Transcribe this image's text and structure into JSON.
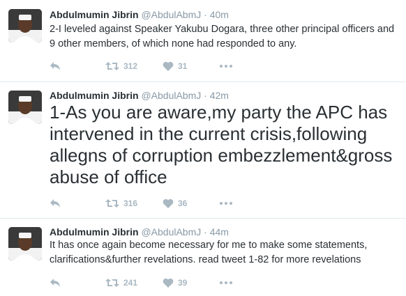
{
  "tweets": [
    {
      "name": "Abdulmumin Jibrin",
      "handle": "@AbdulAbmJ",
      "separator": "·",
      "time": "40m",
      "text": "2-I leveled against Speaker Yakubu Dogara, three other principal officers and 9 other members, of which none had responded to any.",
      "retweets": "312",
      "likes": "31",
      "icons": [
        "reply-icon",
        "retweet-icon",
        "like-icon",
        "more-icon"
      ]
    },
    {
      "name": "Abdulmumin Jibrin",
      "handle": "@AbdulAbmJ",
      "separator": "·",
      "time": "42m",
      "text": "1-As you are aware,my party the APC has intervened in the current crisis,following allegns of corruption embezzlement&gross abuse of office",
      "retweets": "316",
      "likes": "36",
      "icons": [
        "reply-icon",
        "retweet-icon",
        "like-icon",
        "more-icon"
      ]
    },
    {
      "name": "Abdulmumin Jibrin",
      "handle": "@AbdulAbmJ",
      "separator": "·",
      "time": "44m",
      "text": "It has once again become necessary for me to make some statements, clarifications&further revelations. read tweet 1-82 for more revelations",
      "retweets": "241",
      "likes": "39",
      "icons": [
        "reply-icon",
        "retweet-icon",
        "like-icon",
        "more-icon"
      ]
    }
  ],
  "colors": {
    "text": "#292f33",
    "muted": "#8899a6",
    "action": "#aab8c2",
    "divider": "#e1e8ed"
  }
}
